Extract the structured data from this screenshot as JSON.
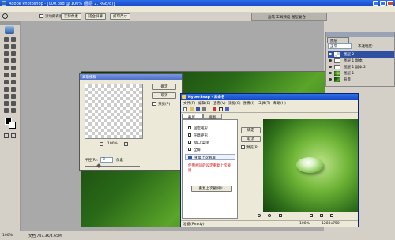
{
  "app": {
    "title": "Adobe Photoshop - [000.psd @ 100% (图层 2, RGB/8)]",
    "options_bar": {
      "check_label": "滚动所有窗口",
      "buttons": [
        "实际像素",
        "适合屏幕",
        "打印尺寸"
      ],
      "right_tab": "画笔 工具预设 图层复合"
    }
  },
  "layers_panel": {
    "tab": "图层",
    "blend_mode": "正常",
    "opacity_label": "不透明度:",
    "layers": [
      {
        "name": "图层 2",
        "selected": true
      },
      {
        "name": "图层 1 副本",
        "selected": false
      },
      {
        "name": "图层 1 副本 2",
        "selected": false
      },
      {
        "name": "图层 1",
        "selected": false
      },
      {
        "name": "背景",
        "selected": false
      }
    ]
  },
  "gaussian_dialog": {
    "title": "高斯模糊",
    "ok": "确定",
    "cancel": "取消",
    "preview": "预览(P)",
    "zoom": "100%",
    "radius_label": "半径(R):",
    "radius_value": "3",
    "unit": "像素"
  },
  "hypersnap": {
    "title": "HyperSnap - 未命名",
    "menu": [
      "文件(F)",
      "编辑(E)",
      "查看(V)",
      "捕捉(C)",
      "图像(I)",
      "工具(T)",
      "帮助(H)"
    ],
    "side_tabs": [
      "截屏",
      "视图"
    ],
    "capture_items": [
      "固定矩形",
      "任意矩形",
      "窗口/菜单",
      "全屏",
      "重复上次截屏"
    ],
    "warning": "使用相同的设定重复上次截屏",
    "bottom_button": "重复上次截屏(L)",
    "ok": "确定",
    "cancel": "取消",
    "preview": "预览(P)",
    "status_left": "准备(Ready)",
    "status_right": "1280x750",
    "zoom": "100%"
  },
  "statusbar": {
    "zoom": "100%",
    "doc": "文档:747.3K/4.65M"
  }
}
